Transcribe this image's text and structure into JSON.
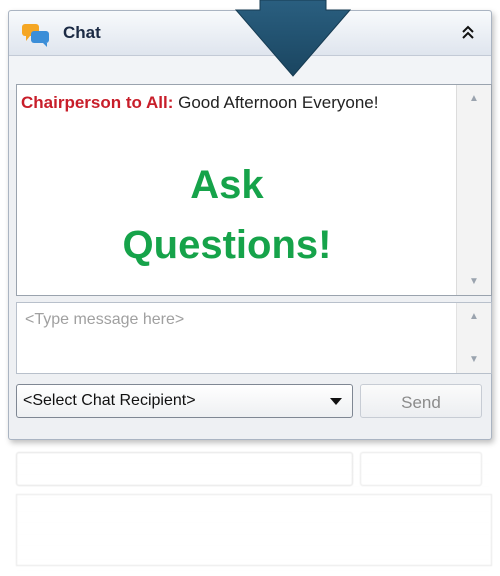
{
  "window": {
    "title": "Chat"
  },
  "messages": {
    "sender": "Chairperson to All:",
    "text": " Good Afternoon Everyone!"
  },
  "overlay": {
    "line1": "Ask",
    "line2": "Questions!"
  },
  "composer": {
    "placeholder": "<Type message here>"
  },
  "recipient": {
    "selected": "<Select Chat Recipient>"
  },
  "send_label": "Send",
  "icons": {
    "title_icon": "chat-bubbles-icon",
    "collapse": "double-chevron-up-icon",
    "dropdown": "caret-down-icon",
    "scroll_up": "scroll-up-icon",
    "scroll_down": "scroll-down-icon",
    "pointer": "down-arrow-icon"
  },
  "colors": {
    "sender": "#c81e2a",
    "overlay": "#16a34a",
    "arrow": "#1f4e6b"
  }
}
